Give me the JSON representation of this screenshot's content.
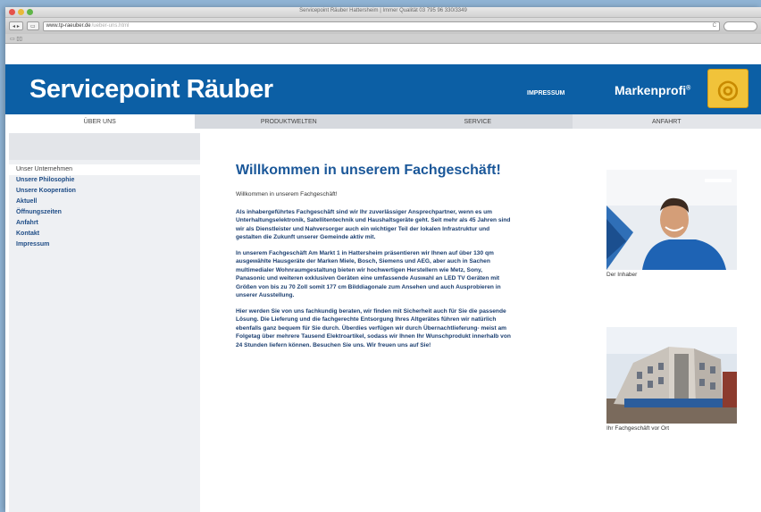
{
  "browser": {
    "window_title": "Servicepoint Räuber Hattersheim | Immer Qualität 03 795 96 330/3349",
    "url": "www.tp-raeuber.de",
    "url_rest": "/ueber-uns.html",
    "reload": "C"
  },
  "header": {
    "brand": "Servicepoint Räuber",
    "impressum": "IMPRESSUM",
    "markenprofi": "Markenprofi",
    "markenprofi_sup": "®"
  },
  "nav": {
    "items": [
      "ÜBER UNS",
      "PRODUKTWELTEN",
      "SERVICE",
      "ANFAHRT"
    ]
  },
  "sidebar": {
    "items": [
      "Unser Unternehmen",
      "Unsere Philosophie",
      "Unsere Kooperation",
      "Aktuell",
      "Öffnungszeiten",
      "Anfahrt",
      "Kontakt",
      "Impressum"
    ]
  },
  "main": {
    "title": "Willkommen in unserem Fachgeschäft!",
    "intro": "Willkommen in unserem Fachgeschäft!",
    "para1": "Als inhabergeführtes Fachgeschäft sind wir Ihr zuverlässiger Ansprechpartner, wenn es um Unterhaltungselektronik, Satellitentechnik und Haushaltsgeräte geht. Seit mehr als 45 Jahren sind wir als Dienstleister und Nahversorger auch ein wichtiger Teil der lokalen Infrastruktur und gestalten die Zukunft unserer Gemeinde aktiv mit.",
    "para2": "In unserem Fachgeschäft Am Markt 1 in Hattersheim präsentieren wir Ihnen auf über 130 qm ausgewählte Hausgeräte der Marken Miele, Bosch, Siemens und AEG, aber auch in Sachen multimedialer Wohnraumgestaltung bieten wir hochwertigen Herstellern wie Metz, Sony, Panasonic und weiteren exklusiven Geräten eine umfassende Auswahl an LED TV Geräten mit Größen von bis zu 70 Zoll somit 177 cm Bilddiagonale zum Ansehen und auch Ausprobieren in unserer Ausstellung.",
    "para3": "Hier werden Sie von uns fachkundig beraten, wir finden mit Sicherheit auch für Sie die passende Lösung. Die Lieferung und die fachgerechte Entsorgung Ihres Altgerätes führen wir natürlich ebenfalls ganz bequem für Sie durch. Überdies verfügen wir durch Übernachtlieferung- meist am Folgetag über mehrere Tausend Elektroartikel, sodass wir Ihnen Ihr Wunschprodukt innerhalb von 24 Stunden liefern können. Besuchen Sie uns. Wir freuen uns auf Sie!"
  },
  "photos": {
    "caption1": "Der Inhaber",
    "caption2": "Ihr Fachgeschäft vor Ort"
  },
  "colors": {
    "brand_blue": "#0c5fa5",
    "logo_yellow": "#f1c33a",
    "link_blue": "#1e4c86"
  }
}
